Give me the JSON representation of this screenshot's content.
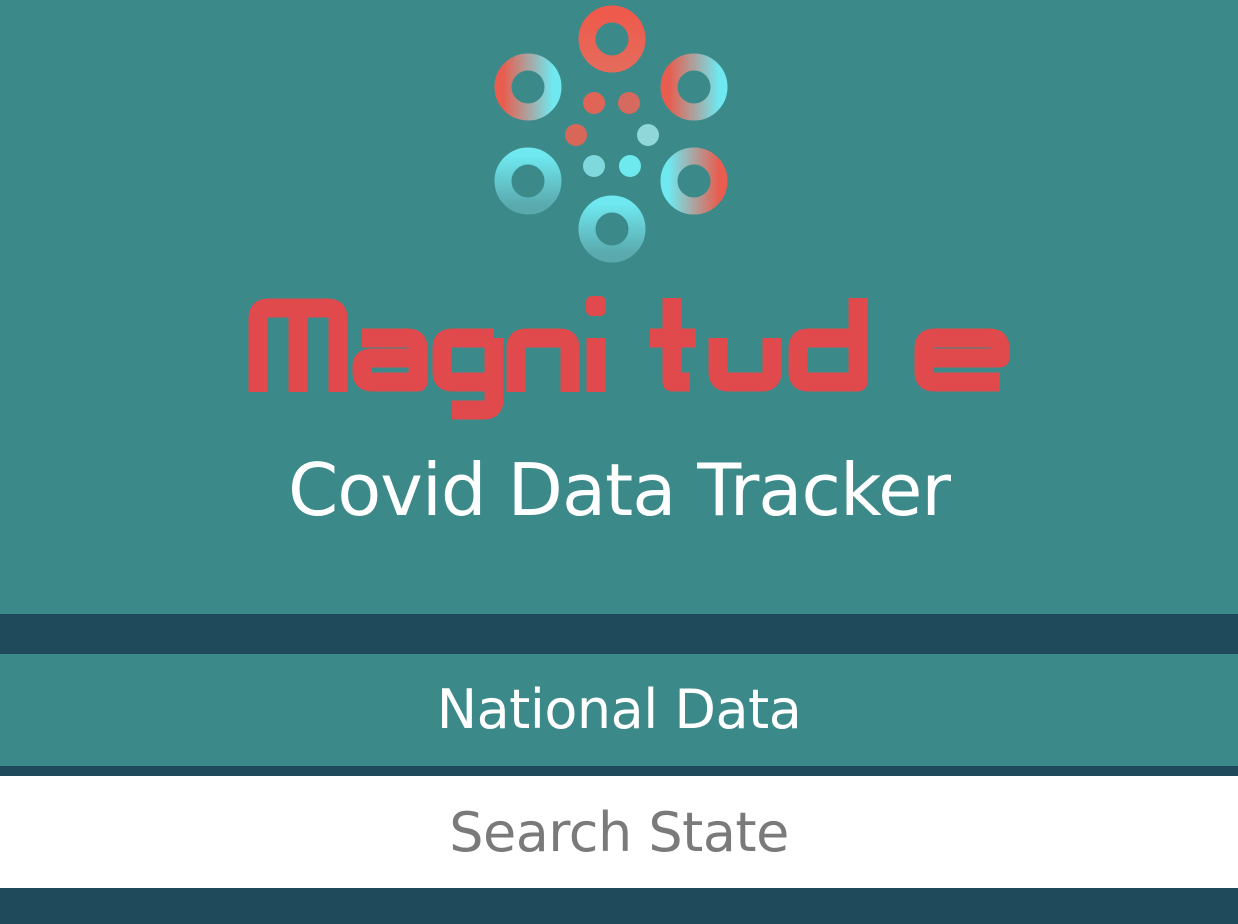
{
  "app": {
    "logo_text": "Magnitude",
    "subtitle": "Covid Data Tracker"
  },
  "nav": {
    "national_label": "National Data"
  },
  "search": {
    "placeholder": "Search State",
    "value": ""
  },
  "colors": {
    "background": "#3c898a",
    "band": "#1e4a5b",
    "brand_red": "#e04a4c",
    "brand_cyan": "#6ee9ee",
    "text": "#ffffff",
    "placeholder": "#7a7a7a"
  },
  "icons": {
    "logo_mark": "ring-cluster-logo-icon"
  }
}
